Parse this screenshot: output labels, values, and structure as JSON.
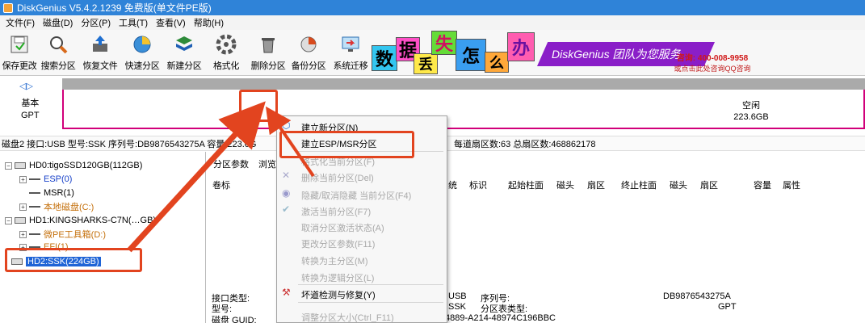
{
  "window": {
    "title": "DiskGenius V5.4.2.1239 免费版(单文件PE版)"
  },
  "menu": [
    "文件(F)",
    "磁盘(D)",
    "分区(P)",
    "工具(T)",
    "查看(V)",
    "帮助(H)"
  ],
  "toolbar": [
    {
      "label": "保存更改",
      "icon": "save-icon"
    },
    {
      "label": "搜索分区",
      "icon": "magnifier-icon"
    },
    {
      "label": "恢复文件",
      "icon": "recover-file-icon"
    },
    {
      "label": "快速分区",
      "icon": "quick-partition-icon"
    },
    {
      "label": "新建分区",
      "icon": "new-partition-icon"
    },
    {
      "label": "格式化",
      "icon": "format-icon"
    },
    {
      "label": "删除分区",
      "icon": "trash-icon"
    },
    {
      "label": "备份分区",
      "icon": "backup-icon"
    },
    {
      "label": "系统迁移",
      "icon": "migrate-icon"
    }
  ],
  "banner": {
    "chars": [
      "数",
      "据",
      "丢",
      "失",
      "怎",
      "么",
      "办"
    ],
    "slogan": "DiskGenius 团队为您服务",
    "phone": "咨询: 400-008-9958",
    "qq": "或点击此处咨询QQ咨询"
  },
  "disk_map": {
    "type_label": "基本",
    "scheme_label": "GPT",
    "free_label": "空闲",
    "free_size": "223.6GB"
  },
  "info_line": {
    "left": "磁盘2 接口:USB  型号:SSK  序列号:DB9876543275A  容量:223.6G",
    "right": "每道扇区数:63  总扇区数:468862178"
  },
  "tree": [
    {
      "label": "HD0:tigoSSD120GB(112GB)",
      "kind": "disk"
    },
    {
      "label": "ESP(0)",
      "kind": "part-blue"
    },
    {
      "label": "MSR(1)",
      "kind": "part"
    },
    {
      "label": "本地磁盘(C:)",
      "kind": "part-orange"
    },
    {
      "label": "HD1:KINGSHARKS-C7N(…GB)",
      "kind": "disk"
    },
    {
      "label": "微PE工具箱(D:)",
      "kind": "part-orange"
    },
    {
      "label": "EFI(1)",
      "kind": "part-orange"
    },
    {
      "label": "HD2:SSK(224GB)",
      "kind": "disk-selected"
    }
  ],
  "tabs": [
    "分区参数",
    "浏览"
  ],
  "columns": [
    "卷标",
    "统",
    "标识",
    "起始柱面",
    "磁头",
    "扇区",
    "终止柱面",
    "磁头",
    "扇区",
    "容量",
    "属性"
  ],
  "details": {
    "iface_label": "接口类型:",
    "model_label": "型号:",
    "guid_label": "磁盘 GUID:",
    "iface_value": "USB",
    "model_value": "SSK",
    "guid_value": "4889-A214-48974C196BBC",
    "sn_label": "序列号:",
    "pt_label": "分区表类型:",
    "sn_value": "DB9876543275A",
    "pt_value": "GPT"
  },
  "context_menu": [
    {
      "label": "建立新分区(N)",
      "enabled": true
    },
    {
      "label": "建立ESP/MSR分区",
      "enabled": true
    },
    {
      "label": "格式化当前分区(F)",
      "enabled": false
    },
    {
      "label": "删除当前分区(Del)",
      "enabled": false
    },
    {
      "label": "隐藏/取消隐藏 当前分区(F4)",
      "enabled": false
    },
    {
      "label": "激活当前分区(F7)",
      "enabled": false
    },
    {
      "label": "取消分区激活状态(A)",
      "enabled": false
    },
    {
      "label": "更改分区参数(F11)",
      "enabled": false
    },
    {
      "label": "转换为主分区(M)",
      "enabled": false
    },
    {
      "label": "转换为逻辑分区(L)",
      "enabled": false
    },
    {
      "label": "坏道检测与修复(Y)",
      "enabled": true
    },
    {
      "label": "调整分区大小(Ctrl_F11)",
      "enabled": false
    }
  ],
  "colors": {
    "title_bar": "#2f83d8",
    "highlight": "#e2441f",
    "disk_border": "#d1007a",
    "selection": "#1f64d6",
    "banner_purple": "#8a1ec8"
  }
}
